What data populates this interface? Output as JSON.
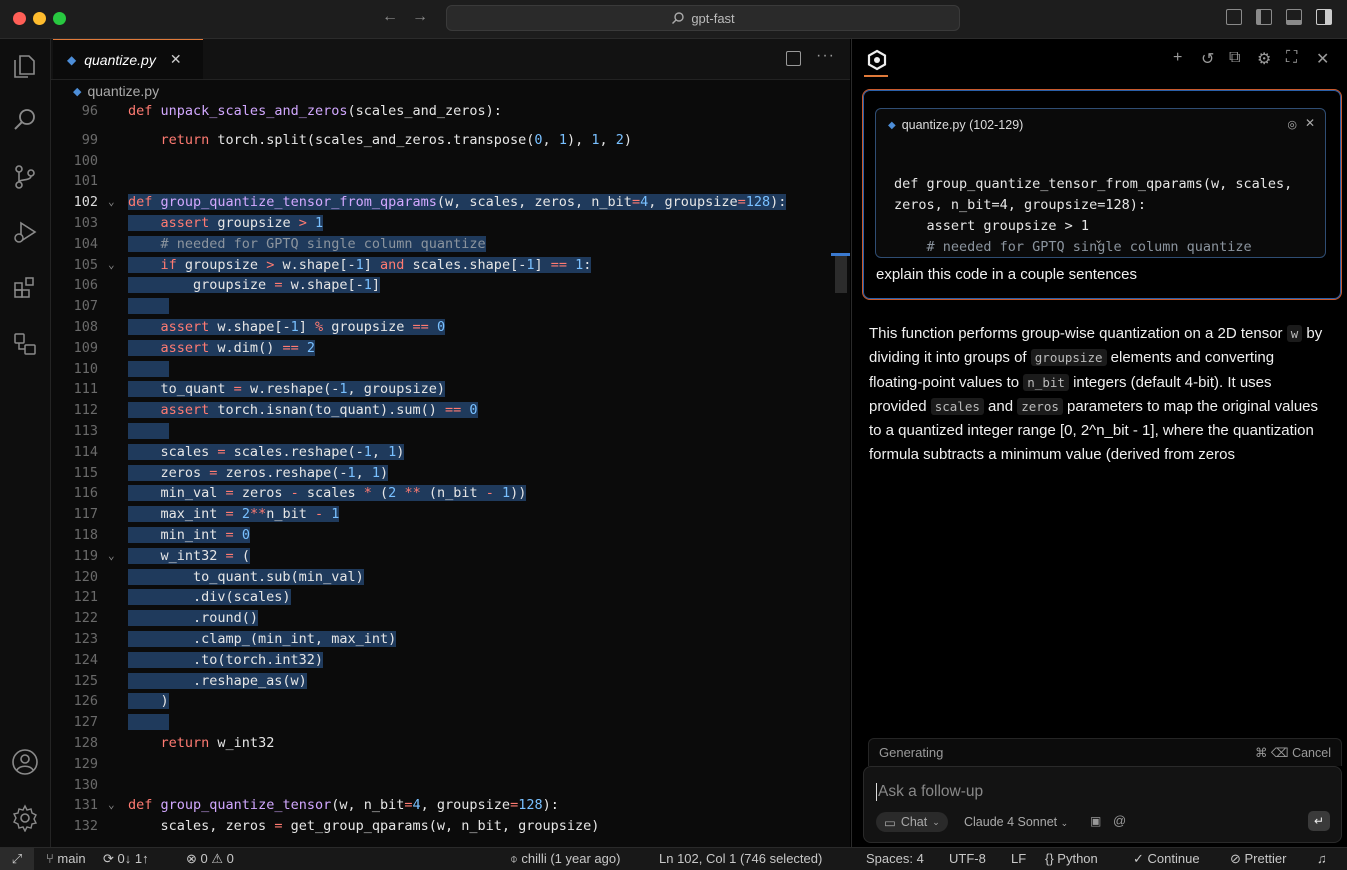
{
  "window": {
    "title": "gpt-fast"
  },
  "editor": {
    "tab_label": "quantize.py",
    "breadcrumb": "quantize.py",
    "lines": [
      {
        "n": "96",
        "t": "def unpack_scales_and_zeros(scales_and_zeros):"
      },
      {
        "n": "99",
        "t": "    return torch.split(scales_and_zeros.transpose(0, 1), 1, 2)"
      },
      {
        "n": "100",
        "t": ""
      },
      {
        "n": "101",
        "t": ""
      },
      {
        "n": "102",
        "t": "def group_quantize_tensor_from_qparams(w, scales, zeros, n_bit=4, groupsize=128):"
      },
      {
        "n": "103",
        "t": "    assert groupsize > 1"
      },
      {
        "n": "104",
        "t": "    # needed for GPTQ single column quantize"
      },
      {
        "n": "105",
        "t": "    if groupsize > w.shape[-1] and scales.shape[-1] == 1:"
      },
      {
        "n": "106",
        "t": "        groupsize = w.shape[-1]"
      },
      {
        "n": "107",
        "t": ""
      },
      {
        "n": "108",
        "t": "    assert w.shape[-1] % groupsize == 0"
      },
      {
        "n": "109",
        "t": "    assert w.dim() == 2"
      },
      {
        "n": "110",
        "t": ""
      },
      {
        "n": "111",
        "t": "    to_quant = w.reshape(-1, groupsize)"
      },
      {
        "n": "112",
        "t": "    assert torch.isnan(to_quant).sum() == 0"
      },
      {
        "n": "113",
        "t": ""
      },
      {
        "n": "114",
        "t": "    scales = scales.reshape(-1, 1)"
      },
      {
        "n": "115",
        "t": "    zeros = zeros.reshape(-1, 1)"
      },
      {
        "n": "116",
        "t": "    min_val = zeros - scales * (2 ** (n_bit - 1))"
      },
      {
        "n": "117",
        "t": "    max_int = 2**n_bit - 1"
      },
      {
        "n": "118",
        "t": "    min_int = 0"
      },
      {
        "n": "119",
        "t": "    w_int32 = ("
      },
      {
        "n": "120",
        "t": "        to_quant.sub(min_val)"
      },
      {
        "n": "121",
        "t": "        .div(scales)"
      },
      {
        "n": "122",
        "t": "        .round()"
      },
      {
        "n": "123",
        "t": "        .clamp_(min_int, max_int)"
      },
      {
        "n": "124",
        "t": "        .to(torch.int32)"
      },
      {
        "n": "125",
        "t": "        .reshape_as(w)"
      },
      {
        "n": "126",
        "t": "    )"
      },
      {
        "n": "127",
        "t": ""
      },
      {
        "n": "128",
        "t": "    return w_int32"
      },
      {
        "n": "129",
        "t": ""
      },
      {
        "n": "130",
        "t": ""
      },
      {
        "n": "131",
        "t": "def group_quantize_tensor(w, n_bit=4, groupsize=128):"
      },
      {
        "n": "132",
        "t": "    scales, zeros = get_group_qparams(w, n_bit, groupsize)"
      }
    ]
  },
  "chat": {
    "context_file": "quantize.py (102-129)",
    "context_code": [
      "def group_quantize_tensor_from_qparams(w, scales,",
      "zeros, n_bit=4, groupsize=128):",
      "    assert groupsize > 1",
      "    # needed for GPTQ single column quantize"
    ],
    "question": "explain this code in a couple sentences",
    "answer": {
      "p1": "This function performs group-wise quantization on a 2D tensor ",
      "c1": "w",
      "p2": " by dividing it into groups of ",
      "c2": "groupsize",
      "p3": " elements and converting floating-point values to ",
      "c3": "n_bit",
      "p4": " integers (default 4-bit). It uses provided ",
      "c4": "scales",
      "p5": " and ",
      "c5": "zeros",
      "p6": " parameters to map the original values to a quantized integer range [0, 2^n_bit - 1], where the quantization formula subtracts a minimum value (derived from zeros"
    },
    "generating_label": "Generating",
    "cancel_label": "⌘ ⌫ Cancel",
    "input_placeholder": "Ask a follow-up",
    "mode_label": "Chat",
    "model_label": "Claude 4 Sonnet"
  },
  "status": {
    "branch": "main",
    "sync": "0↓ 1↑",
    "problems_errors": "0",
    "problems_warnings": "0",
    "blame": "chilli (1 year ago)",
    "cursor": "Ln 102, Col 1 (746 selected)",
    "spaces": "Spaces: 4",
    "encoding": "UTF-8",
    "eol": "LF",
    "language": "Python",
    "continue": "Continue",
    "prettier": "Prettier"
  },
  "colors": {
    "accent": "#e07a3a",
    "selection": "#1f3a5c",
    "keyword": "#ff7b72",
    "function": "#d2a8ff",
    "number": "#79c0ff"
  }
}
